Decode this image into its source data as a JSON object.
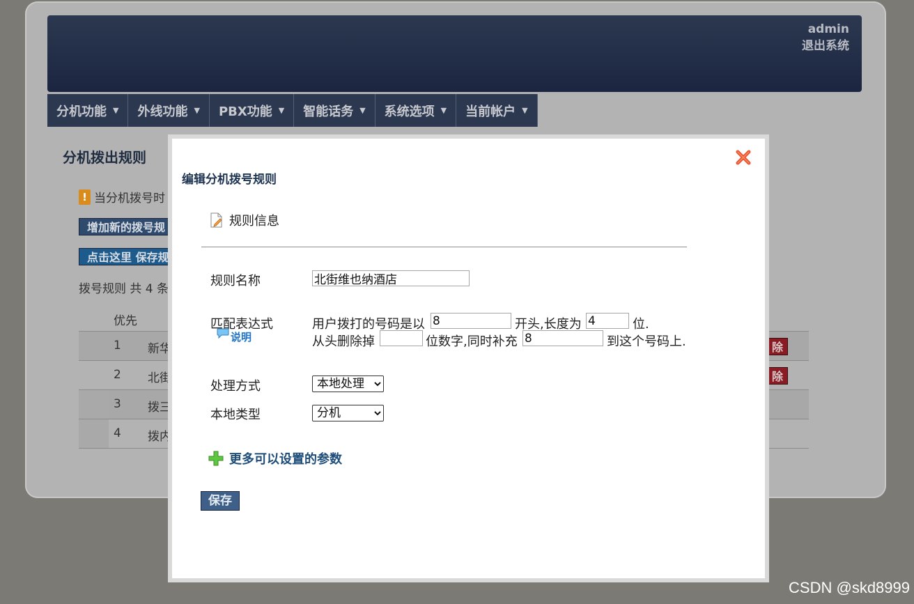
{
  "header": {
    "username": "admin",
    "logout_label": "退出系统"
  },
  "nav": [
    {
      "label": "分机功能"
    },
    {
      "label": "外线功能"
    },
    {
      "label": "PBX功能"
    },
    {
      "label": "智能话务"
    },
    {
      "label": "系统选项"
    },
    {
      "label": "当前帐户"
    }
  ],
  "background_page": {
    "title": "分机拨出规则",
    "warning_text": "当分机拨号时",
    "add_button_label": "增加新的拨号规",
    "save_button_label": "点击这里 保存规",
    "count_text": "拨号规则 共 4 条",
    "table": {
      "header_col1": "优先",
      "rows": [
        {
          "priority": "1",
          "name": "新华",
          "delete_label": "除"
        },
        {
          "priority": "2",
          "name": "北街",
          "delete_label": "除"
        },
        {
          "priority": "3",
          "name": "拨三"
        },
        {
          "priority": "4",
          "name": "拨内"
        }
      ]
    }
  },
  "modal": {
    "title": "编辑分机拨号规则",
    "section_label": "规则信息",
    "rule_name": {
      "label": "规则名称",
      "value": "北街维也纳酒店"
    },
    "match_expression": {
      "label": "匹配表达式",
      "help_label": "说明",
      "prefix_text": "用户拨打的号码是以",
      "prefix_value": "8",
      "length_text": "开头,长度为",
      "length_value": "4",
      "unit_text": "位.",
      "strip_text": "从头删除掉",
      "strip_value": "",
      "digits_text": "位数字,同时补充",
      "prepend_value": "8",
      "end_text": "到这个号码上."
    },
    "handling": {
      "label": "处理方式",
      "selected": "本地处理"
    },
    "local_type": {
      "label": "本地类型",
      "selected": "分机"
    },
    "more_params_label": "更多可以设置的参数",
    "save_label": "保存"
  },
  "watermark": "CSDN @skd8999"
}
